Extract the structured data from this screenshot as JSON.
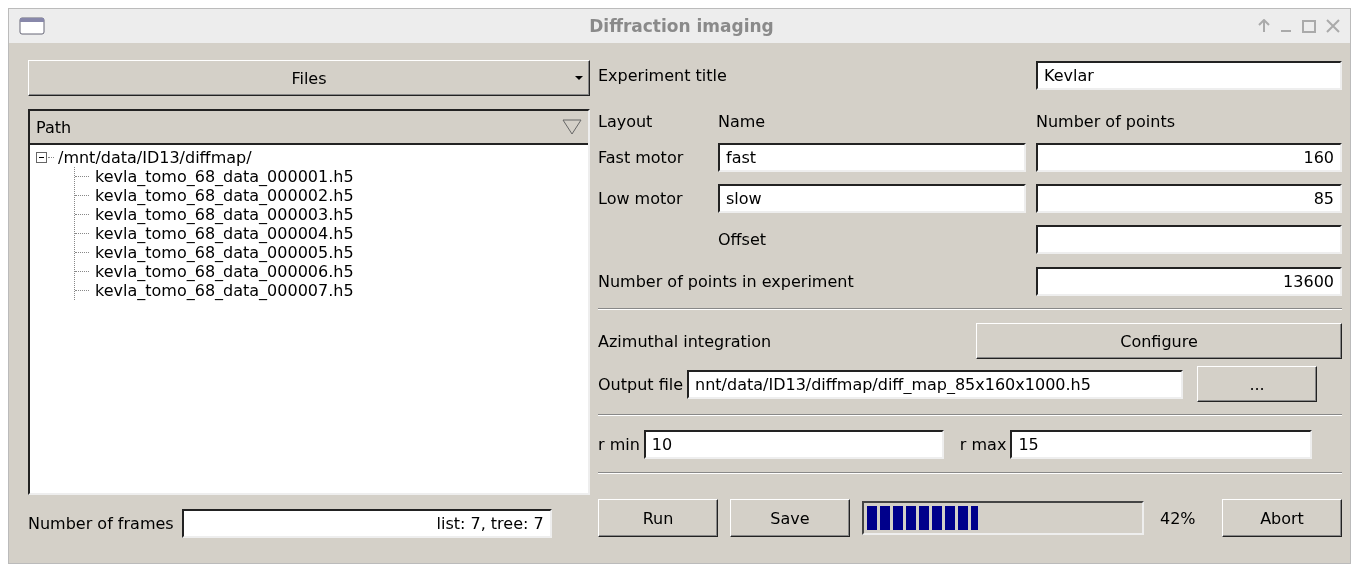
{
  "window": {
    "title": "Diffraction imaging"
  },
  "files_button": {
    "label": "Files"
  },
  "tree": {
    "header": "Path",
    "root": {
      "label": "/mnt/data/ID13/diffmap/",
      "expanded": true,
      "children": [
        {
          "label": "kevla_tomo_68_data_000001.h5"
        },
        {
          "label": "kevla_tomo_68_data_000002.h5"
        },
        {
          "label": "kevla_tomo_68_data_000003.h5"
        },
        {
          "label": "kevla_tomo_68_data_000004.h5"
        },
        {
          "label": "kevla_tomo_68_data_000005.h5"
        },
        {
          "label": "kevla_tomo_68_data_000006.h5"
        },
        {
          "label": "kevla_tomo_68_data_000007.h5"
        }
      ]
    }
  },
  "frames": {
    "label": "Number of frames",
    "value": "list: 7, tree: 7"
  },
  "experiment_title": {
    "label": "Experiment title",
    "value": "Kevlar"
  },
  "layout": {
    "label": "Layout",
    "name_header": "Name",
    "points_header": "Number of points",
    "motors": [
      {
        "label": "Fast motor",
        "name": "fast",
        "points": "160"
      },
      {
        "label": "Low motor",
        "name": "slow",
        "points": "85"
      }
    ],
    "offset_label": "Offset"
  },
  "total_points": {
    "label": "Number of points in experiment",
    "value": "13600"
  },
  "azimuthal": {
    "label": "Azimuthal integration",
    "button": "Configure"
  },
  "output_file": {
    "label": "Output file",
    "value": "nnt/data/ID13/diffmap/diff_map_85x160x1000.h5",
    "browse": "..."
  },
  "r_min": {
    "label": "r min",
    "value": "10"
  },
  "r_max": {
    "label": "r max",
    "value": "15"
  },
  "actions": {
    "run": "Run",
    "save": "Save",
    "abort": "Abort",
    "progress": {
      "level": 0.42,
      "reading": "42%"
    }
  }
}
